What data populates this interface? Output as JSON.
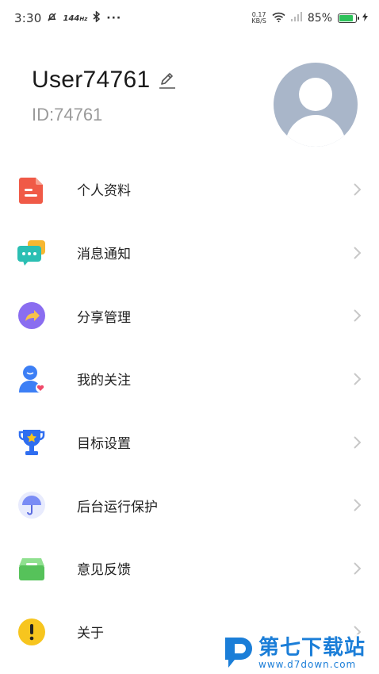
{
  "status_bar": {
    "time": "3:30",
    "refresh_rate": "144",
    "refresh_unit": "Hz",
    "more": "···",
    "net_speed_value": "0.17",
    "net_speed_unit": "KB/S",
    "battery_percent": "85%",
    "battery_level": 0.85
  },
  "profile": {
    "username": "User74761",
    "user_id": "ID:74761"
  },
  "menu": {
    "items": [
      {
        "label": "个人资料",
        "icon": "profile-document-icon",
        "color": "#f05a47"
      },
      {
        "label": "消息通知",
        "icon": "message-notification-icon",
        "color": "#2bbfb3"
      },
      {
        "label": "分享管理",
        "icon": "share-arrow-icon",
        "color": "#8a6df0"
      },
      {
        "label": "我的关注",
        "icon": "user-heart-icon",
        "color": "#3d7ff5"
      },
      {
        "label": "目标设置",
        "icon": "trophy-icon",
        "color": "#2f6ef0"
      },
      {
        "label": "后台运行保护",
        "icon": "umbrella-icon",
        "color": "#7a8cf5"
      },
      {
        "label": "意见反馈",
        "icon": "feedback-box-icon",
        "color": "#56c25a"
      },
      {
        "label": "关于",
        "icon": "exclamation-icon",
        "color": "#f7c51e"
      }
    ]
  },
  "watermark": {
    "title": "第七下载站",
    "url": "www.d7down.com"
  }
}
